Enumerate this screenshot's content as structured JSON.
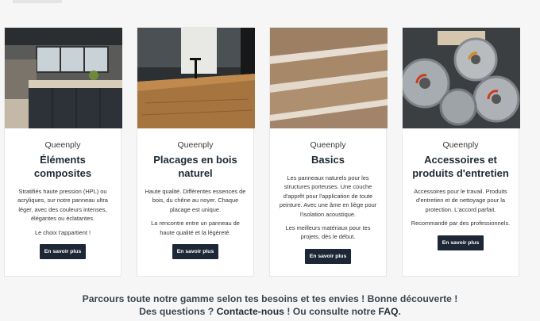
{
  "cards": [
    {
      "image_icon": "kitchen-photo",
      "brand": "Queenply",
      "title": "Éléments composites",
      "description": "Stratifiés haute pression (HPL) ou acryliques, sur notre panneau ultra léger, avec des couleurs intenses, élégantes ou éclatantes.",
      "tagline": "Le choix t'appartient !",
      "button": "En savoir plus"
    },
    {
      "image_icon": "veneer-countertop-photo",
      "brand": "Queenply",
      "title": "Placages en bois naturel",
      "description": "Haute qualité. Différentes essences de bois, du chêne au noyer. Chaque placage est unique.",
      "tagline": "La rencontre entre un panneau de haute qualité et la légèreté.",
      "button": "En savoir plus"
    },
    {
      "image_icon": "plywood-stack-photo",
      "brand": "Queenply",
      "title": "Basics",
      "description": "Les panneaux naturels pour les structures porteuses. Une couche d'apprêt pour l'application de toute peinture. Avec une âme en liège pour l'isolation acoustique.",
      "tagline": "Les meilleurs matériaux pour tes projets, dès le début.",
      "button": "En savoir plus"
    },
    {
      "image_icon": "saw-blades-photo",
      "brand": "Queenply",
      "title": "Accessoires et produits d'entretien",
      "description": "Accessoires pour le travail. Produits d'entretien et de nettoyage pour la protection. L'accord parfait.",
      "tagline": "Recommandé par des professionnels.",
      "button": "En savoir plus"
    }
  ],
  "footer": {
    "line1": "Parcours toute notre gamme selon tes besoins et tes envies ! Bonne découverte !",
    "line2_prefix": "Des questions ? ",
    "contact_link": "Contacte-nous",
    "line2_middle": " ! Ou consulte notre ",
    "faq_link": "FAQ",
    "line2_suffix": "."
  },
  "colors": {
    "button_bg": "#1e2735",
    "title": "#1e2a33",
    "footer_text": "#3b4650"
  }
}
